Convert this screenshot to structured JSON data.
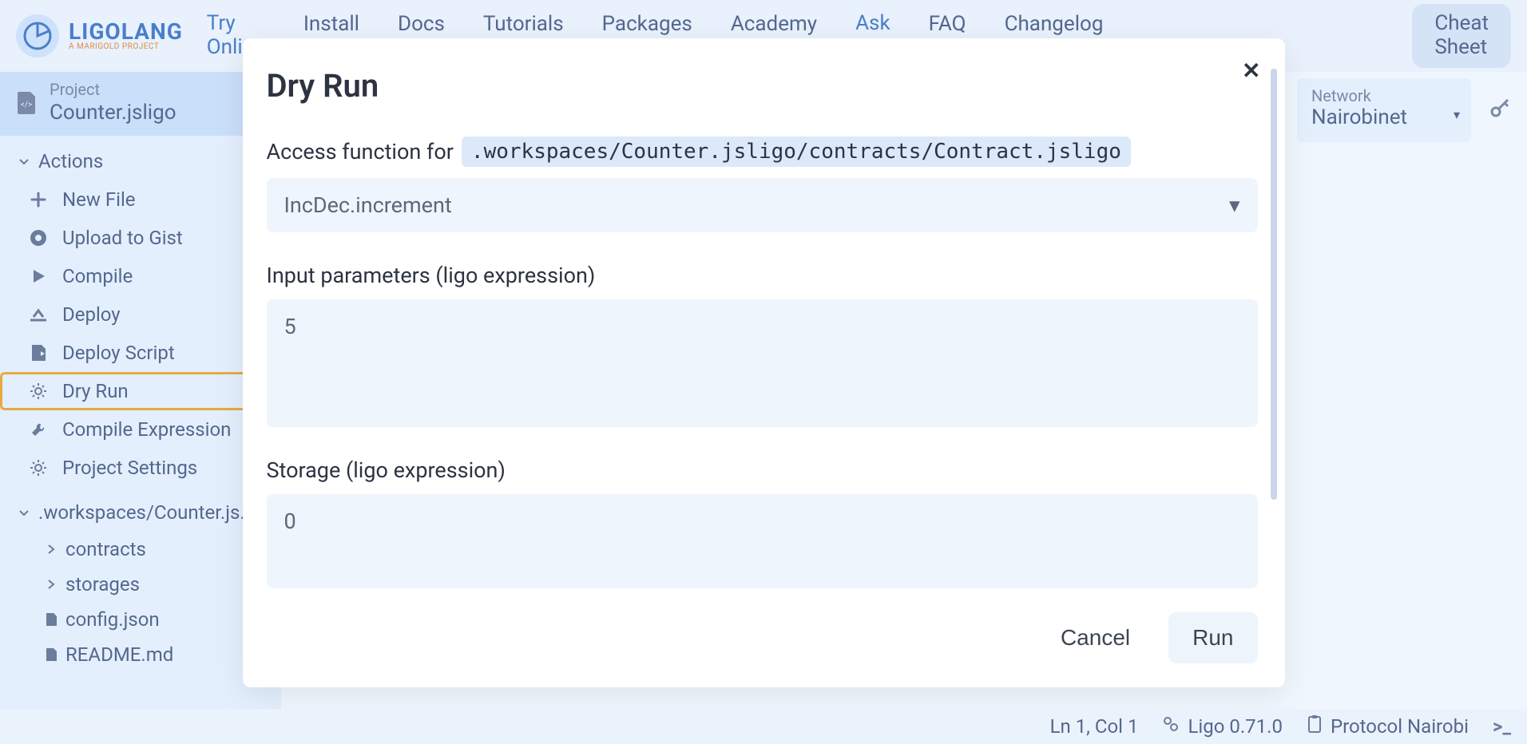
{
  "brand": {
    "name": "LIGOLANG",
    "subtitle": "A MARIGOLD PROJECT"
  },
  "nav": {
    "try": {
      "line1": "Try",
      "line2": "Online"
    },
    "install": "Install",
    "docs": "Docs",
    "tutorials": "Tutorials",
    "packages": "Packages",
    "academy": "Academy",
    "ask": {
      "line1": "Ask"
    },
    "faq": "FAQ",
    "changelog": "Changelog",
    "cheat": {
      "line1": "Cheat",
      "line2": "Sheet"
    }
  },
  "project": {
    "label": "Project",
    "name": "Counter.jsligo"
  },
  "sidebar": {
    "actions_header": "Actions",
    "items": [
      {
        "icon": "plus",
        "label": "New File"
      },
      {
        "icon": "github",
        "label": "Upload to Gist"
      },
      {
        "icon": "play",
        "label": "Compile"
      },
      {
        "icon": "deploy",
        "label": "Deploy"
      },
      {
        "icon": "deploy-script",
        "label": "Deploy Script"
      },
      {
        "icon": "gear",
        "label": "Dry Run",
        "selected": true
      },
      {
        "icon": "wrench",
        "label": "Compile Expression"
      },
      {
        "icon": "gear",
        "label": "Project Settings"
      }
    ],
    "workspace_label": ".workspaces/Counter.js...",
    "tree": [
      {
        "label": "contracts",
        "chev": true
      },
      {
        "label": "storages",
        "chev": true
      },
      {
        "label": "config.json",
        "file": true
      },
      {
        "label": "README.md",
        "file": true
      }
    ]
  },
  "network": {
    "label": "Network",
    "value": "Nairobinet"
  },
  "modal": {
    "title": "Dry Run",
    "access_label": "Access function for",
    "access_path": ".workspaces/Counter.jsligo/contracts/Contract.jsligo",
    "function_selected": "IncDec.increment",
    "params_label": "Input parameters (ligo expression)",
    "params_value": "5",
    "storage_label": "Storage (ligo expression)",
    "storage_value": "0",
    "cancel": "Cancel",
    "run": "Run"
  },
  "status": {
    "cursor": "Ln 1, Col 1",
    "version": "Ligo 0.71.0",
    "protocol": "Protocol Nairobi"
  }
}
